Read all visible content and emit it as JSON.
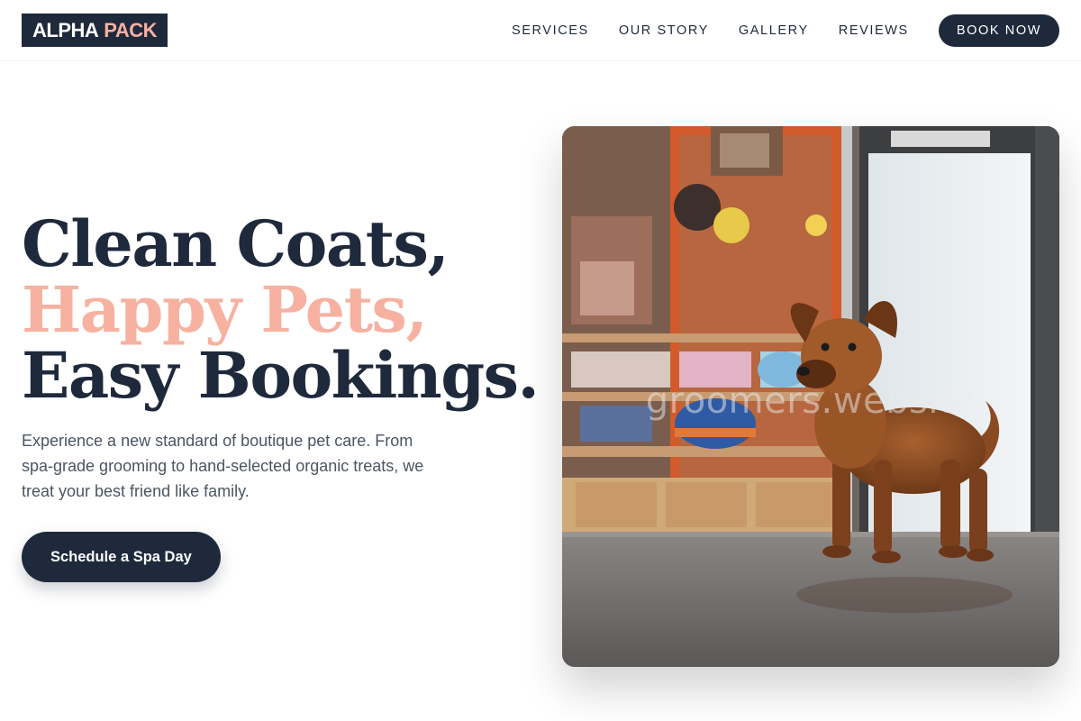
{
  "brand": {
    "name_primary": "ALPHA",
    "name_accent": "PACK"
  },
  "nav": {
    "links": [
      "SERVICES",
      "OUR STORY",
      "GALLERY",
      "REVIEWS"
    ],
    "cta_label": "BOOK NOW"
  },
  "hero": {
    "headline_line1": "Clean Coats,",
    "headline_line2": "Happy Pets,",
    "headline_line3": "Easy Bookings.",
    "lede": "Experience a new standard of boutique pet care. From spa-grade grooming to hand-selected organic treats, we treat your best friend like family.",
    "cta_label": "Schedule a Spa Day",
    "image_watermark": "groomers.website"
  },
  "colors": {
    "navy": "#1e293b",
    "accent_pink": "#f6b1a0",
    "body_text": "#4b5563"
  }
}
